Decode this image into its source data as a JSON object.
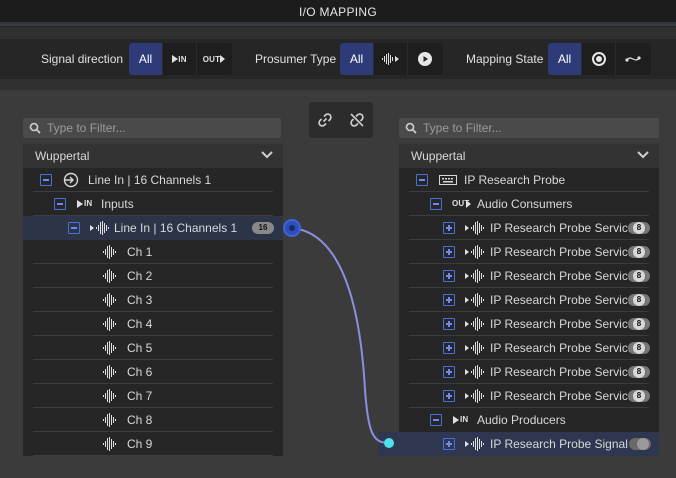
{
  "window": {
    "title": "I/O MAPPING"
  },
  "toolbar": {
    "signal_direction": {
      "label": "Signal direction",
      "options": [
        "All",
        "IN",
        "OUT"
      ],
      "selected": "All"
    },
    "prosumer_type": {
      "label": "Prosumer Type",
      "options": [
        "All"
      ],
      "selected": "All"
    },
    "mapping_state": {
      "label": "Mapping State",
      "options": [
        "All"
      ],
      "selected": "All"
    }
  },
  "left_panel": {
    "filter_placeholder": "Type to Filter...",
    "location": "Wuppertal",
    "device": "Line In | 16 Channels 1",
    "group": "Inputs",
    "group_tag": "IN",
    "selected_item": {
      "label": "Line In | 16 Channels 1",
      "badge": "16"
    },
    "channels": [
      "Ch 1",
      "Ch 2",
      "Ch 3",
      "Ch 4",
      "Ch 5",
      "Ch 6",
      "Ch 7",
      "Ch 8",
      "Ch 9"
    ]
  },
  "right_panel": {
    "filter_placeholder": "Type to Filter...",
    "location": "Wuppertal",
    "device": "IP Research Probe",
    "consumers_group": "Audio Consumers",
    "consumers_tag": "OUT",
    "consumers": [
      {
        "label": "IP Research Probe Servic...",
        "badge": "8"
      },
      {
        "label": "IP Research Probe Servic...",
        "badge": "8"
      },
      {
        "label": "IP Research Probe Servic...",
        "badge": "8"
      },
      {
        "label": "IP Research Probe Servic...",
        "badge": "8"
      },
      {
        "label": "IP Research Probe Servic...",
        "badge": "8"
      },
      {
        "label": "IP Research Probe Servic...",
        "badge": "8"
      },
      {
        "label": "IP Research Probe Servic...",
        "badge": "8"
      },
      {
        "label": "IP Research Probe Servic...",
        "badge": "8"
      }
    ],
    "producers_group": "Audio Producers",
    "producers_tag": "IN",
    "producer_item": {
      "label": "IP Research Probe Signal ..."
    }
  },
  "colors": {
    "accent": "#2f3a78",
    "connection": "#8a8fe0",
    "endpoint": "#4fe0ee"
  }
}
